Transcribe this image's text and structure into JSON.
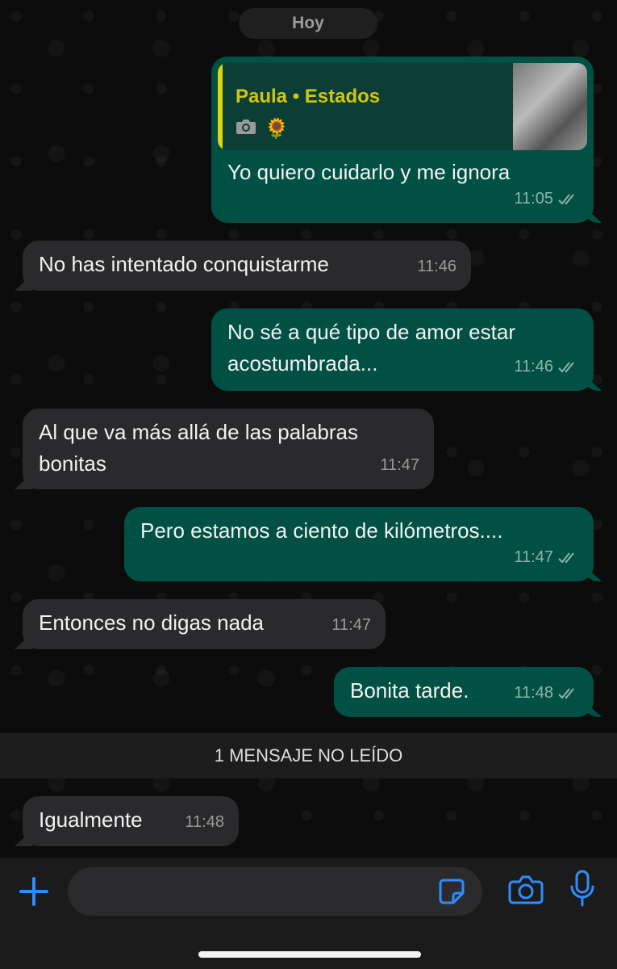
{
  "day_label": "Hoy",
  "reply": {
    "author": "Paula • Estados",
    "emoji": "🌻"
  },
  "messages": [
    {
      "direction": "out",
      "text": "Yo quiero cuidarlo y me ignora",
      "time": "11:05"
    },
    {
      "direction": "in",
      "text": "No has intentado conquistarme",
      "time": "11:46"
    },
    {
      "direction": "out",
      "text": "No sé a qué tipo de amor estar\nacostumbrada...",
      "time": "11:46"
    },
    {
      "direction": "in",
      "text": "Al que va más allá de las palabras\nbonitas",
      "time": "11:47"
    },
    {
      "direction": "out",
      "text": "Pero estamos a ciento de kilómetros....",
      "time": "11:47"
    },
    {
      "direction": "in",
      "text": "Entonces no digas nada",
      "time": "11:47"
    },
    {
      "direction": "out",
      "text": "Bonita tarde.",
      "time": "11:48"
    },
    {
      "direction": "in",
      "text": "Igualmente",
      "time": "11:48"
    }
  ],
  "unread_label": "1 MENSAJE NO LEÍDO",
  "composer": {
    "value": "",
    "placeholder": ""
  },
  "colors": {
    "accent": "#2f8cff",
    "outgoing_bubble": "#005144",
    "incoming_bubble": "#2a2a2c",
    "reply_author": "#d0c417"
  },
  "icons": [
    "camera-icon",
    "sunflower-emoji",
    "double-check-icon",
    "plus-icon",
    "sticker-icon",
    "camera-icon",
    "microphone-icon"
  ]
}
